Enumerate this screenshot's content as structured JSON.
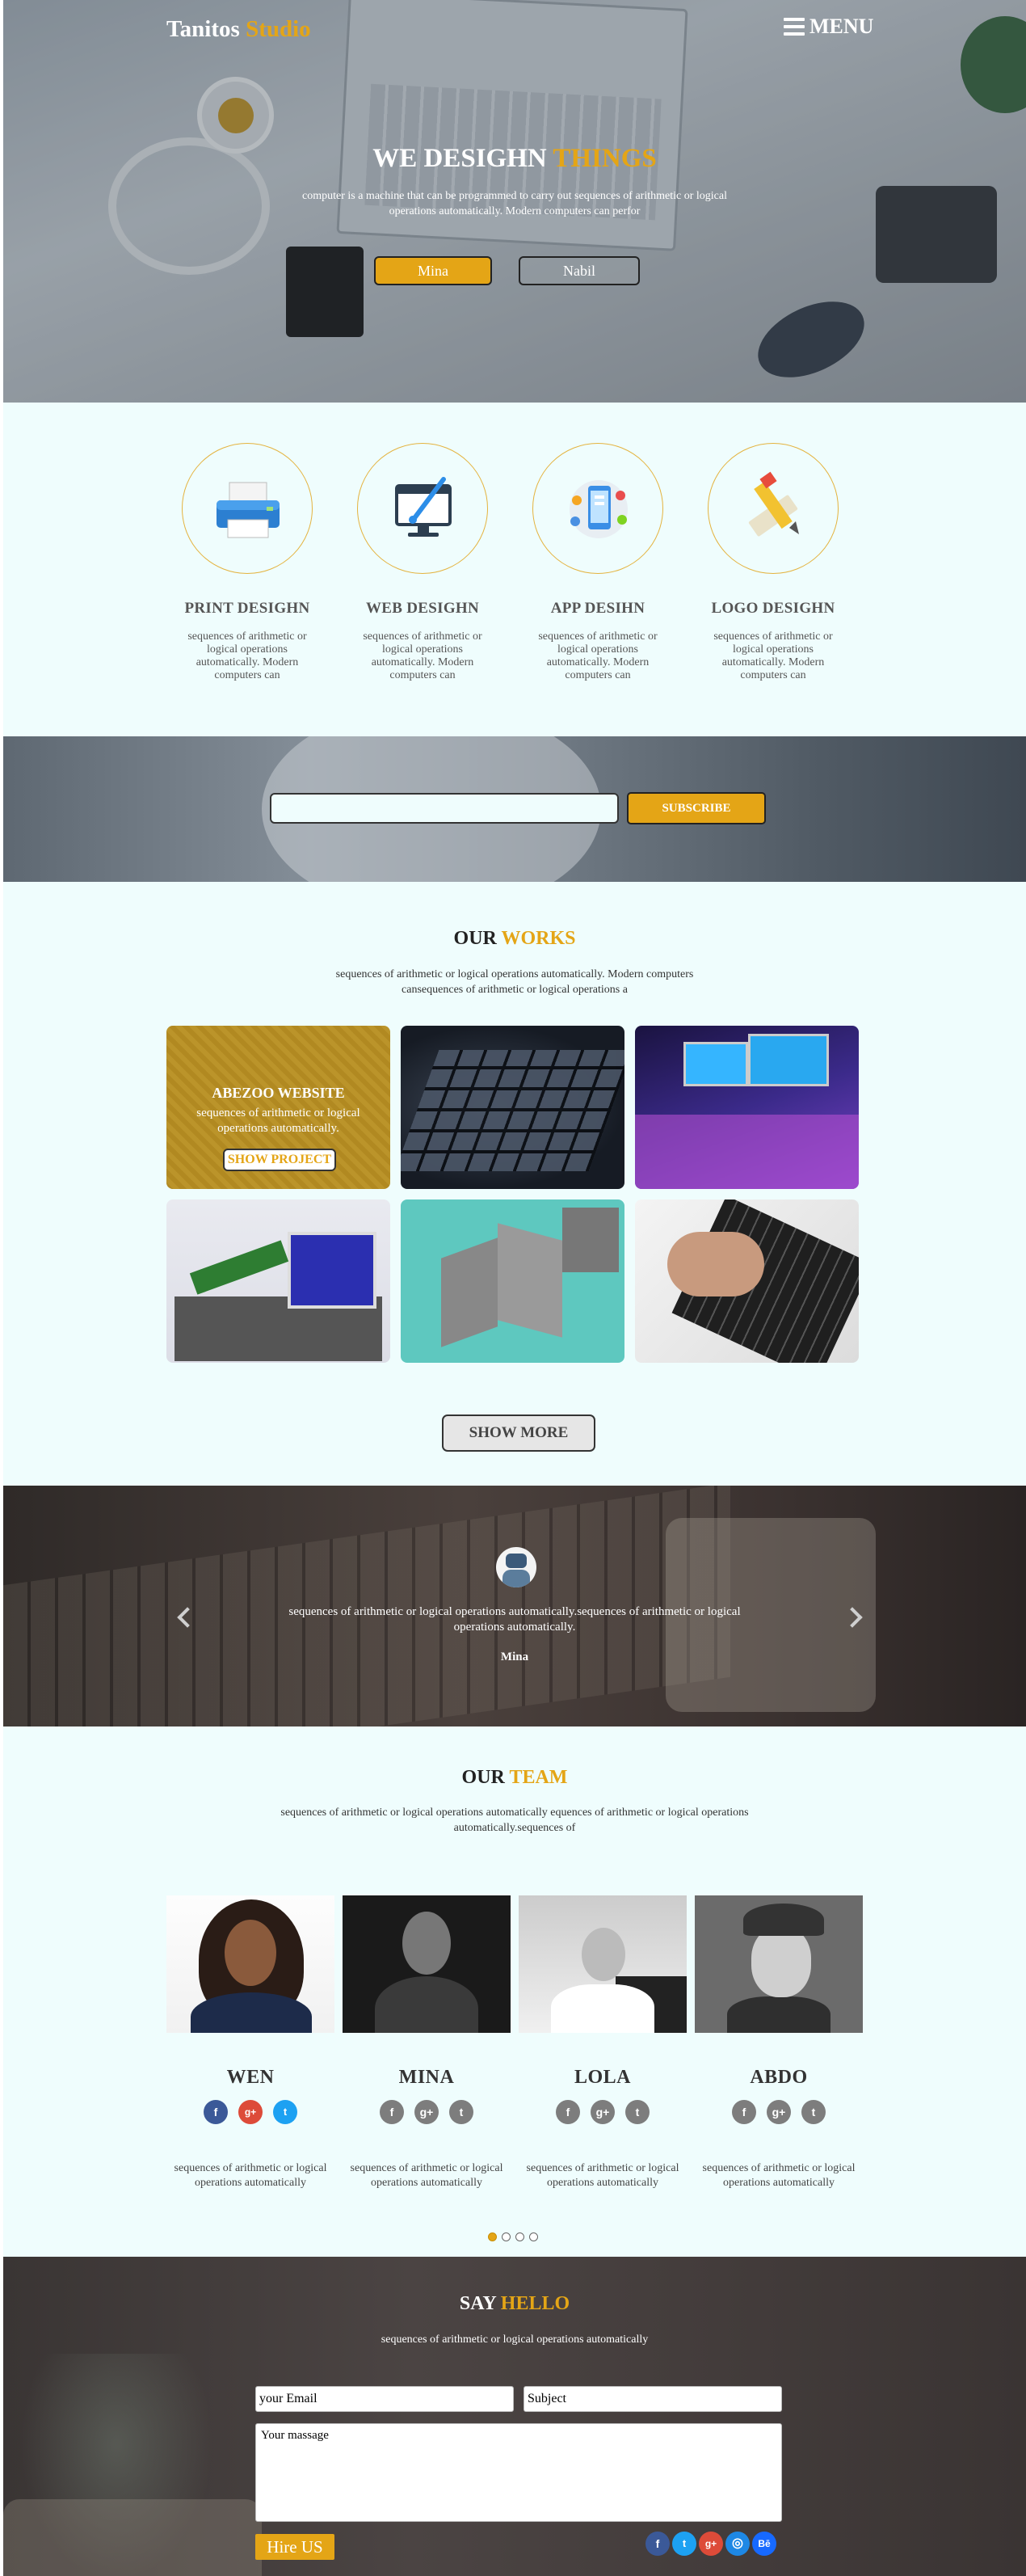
{
  "header": {
    "logo_part1": "Tanitos",
    "logo_part2": "Studio",
    "menu_label": "MENU"
  },
  "hero": {
    "title_part1": "WE DESIGHN",
    "title_part2": "THINGS",
    "text": "computer is a machine that can be programmed to carry out sequences of arithmetic or logical operations automatically. Modern computers can perfor",
    "button_primary": "Mina",
    "button_secondary": "Nabil"
  },
  "services": [
    {
      "title": "PRINT DESIGHN",
      "icon": "printer-icon",
      "text": "sequences of arithmetic or logical operations automatically. Modern computers can"
    },
    {
      "title": "WEB DESIGHN",
      "icon": "monitor-brush-icon",
      "text": "sequences of arithmetic or logical operations automatically. Modern computers can"
    },
    {
      "title": "APP DESIHN",
      "icon": "mobile-app-icon",
      "text": "sequences of arithmetic or logical operations automatically. Modern computers can"
    },
    {
      "title": "LOGO DESIGHN",
      "icon": "pencil-ruler-icon",
      "text": "sequences of arithmetic or logical operations automatically. Modern computers can"
    }
  ],
  "subscribe": {
    "input_value": "",
    "button_label": "SUBSCRIBE"
  },
  "works": {
    "title_part1": "OUR",
    "title_part2": "WORKS",
    "subtitle": "sequences of arithmetic or logical operations automatically. Modern computers cansequences of arithmetic or logical operations a",
    "featured": {
      "title": "ABEZOO WEBSITE",
      "text": "sequences of arithmetic or logical operations automatically.",
      "button": "SHOW PROJECT"
    },
    "show_more": "SHOW MORE"
  },
  "testimonial": {
    "quote": "sequences of arithmetic or logical operations automatically.sequences of arithmetic or logical operations automatically.",
    "author": "Mina"
  },
  "team": {
    "title_part1": "OUR",
    "title_part2": "TEAM",
    "subtitle": "sequences of arithmetic or logical operations automatically equences of arithmetic or logical operations automatically.sequences of",
    "members": [
      {
        "name": "WEN",
        "desc": "sequences of arithmetic or logical operations automatically"
      },
      {
        "name": "MINA",
        "desc": "sequences of arithmetic or logical operations automatically"
      },
      {
        "name": "LOLA",
        "desc": "sequences of arithmetic or logical operations automatically"
      },
      {
        "name": "ABDO",
        "desc": "sequences of arithmetic or logical operations automatically"
      }
    ],
    "social_glyphs": {
      "facebook": "f",
      "googleplus": "g+",
      "twitter": "t"
    },
    "carousel_active_index": 0
  },
  "contact": {
    "title_part1": "SAY",
    "title_part2": "HELLO",
    "subtitle": "sequences of arithmetic or logical operations automatically",
    "email_value": "your Email",
    "subject_value": "Subject",
    "message_value": "Your massage",
    "hire_button": "Hire US",
    "social_glyphs": {
      "facebook": "f",
      "twitter": "t",
      "googleplus": "g+",
      "web": "◎",
      "behance": "Bē"
    }
  },
  "colors": {
    "accent": "#e4a516",
    "section_bg": "#effdfd"
  }
}
